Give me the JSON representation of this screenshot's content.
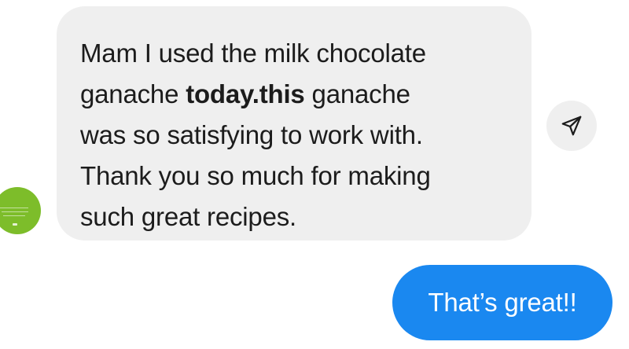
{
  "thread": {
    "incoming": {
      "lines": [
        {
          "before": "Mam I used the milk chocolate",
          "bold": "",
          "after": ""
        },
        {
          "before": "ganache ",
          "bold": "today.this",
          "after": " ganache"
        },
        {
          "before": "was so satisfying to work with.",
          "bold": "",
          "after": ""
        },
        {
          "before": "Thank you so much for making",
          "bold": "",
          "after": ""
        },
        {
          "before": "such great recipes.",
          "bold": "",
          "after": ""
        }
      ],
      "avatar_color": "#7dbd2a",
      "bubble_color": "#efefef"
    },
    "share_icon": "paper-plane-icon",
    "outgoing": {
      "text": "That’s great!!",
      "bubble_color": "#1a88f0"
    }
  }
}
